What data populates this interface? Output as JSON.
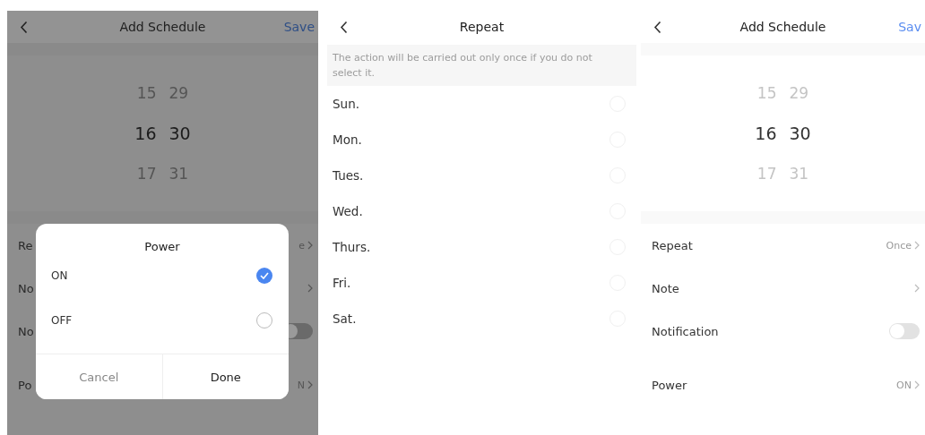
{
  "screens": [
    {
      "kind": "schedule",
      "dimmed": true,
      "title": "Add Schedule",
      "action": "Save",
      "picker": [
        {
          "hour": "15",
          "minute": "29",
          "selected": false
        },
        {
          "hour": "16",
          "minute": "30",
          "selected": true
        },
        {
          "hour": "17",
          "minute": "31",
          "selected": false
        }
      ],
      "rows": [
        {
          "kind": "link",
          "label": "Re",
          "value": "e"
        },
        {
          "kind": "link",
          "label": "No"
        },
        {
          "kind": "toggle",
          "label": "No",
          "on": false
        },
        {
          "kind": "link",
          "label": "Po",
          "value": "N",
          "separated": true
        }
      ],
      "dialog": {
        "title": "Power",
        "options": [
          {
            "label": "ON",
            "selected": true
          },
          {
            "label": "OFF",
            "selected": false
          }
        ],
        "buttons": [
          {
            "label": "Cancel",
            "kind": "secondary"
          },
          {
            "label": "Done",
            "kind": "primary"
          }
        ]
      }
    },
    {
      "kind": "repeat",
      "title": "Repeat",
      "hint": "The action will be carried out only once if you do not select it.",
      "days": [
        {
          "label": "Sun.",
          "selected": false
        },
        {
          "label": "Mon.",
          "selected": false
        },
        {
          "label": "Tues.",
          "selected": false
        },
        {
          "label": "Wed.",
          "selected": false
        },
        {
          "label": "Thurs.",
          "selected": false
        },
        {
          "label": "Fri.",
          "selected": false
        },
        {
          "label": "Sat.",
          "selected": false
        }
      ]
    },
    {
      "kind": "schedule",
      "dimmed": false,
      "title": "Add Schedule",
      "action": "Sav",
      "picker": [
        {
          "hour": "15",
          "minute": "29",
          "selected": false
        },
        {
          "hour": "16",
          "minute": "30",
          "selected": true
        },
        {
          "hour": "17",
          "minute": "31",
          "selected": false
        }
      ],
      "rows": [
        {
          "kind": "link",
          "label": "Repeat",
          "value": "Once"
        },
        {
          "kind": "link",
          "label": "Note"
        },
        {
          "kind": "toggle",
          "label": "Notification",
          "on": false
        },
        {
          "kind": "link",
          "label": "Power",
          "value": "ON",
          "separated": true
        }
      ]
    }
  ]
}
